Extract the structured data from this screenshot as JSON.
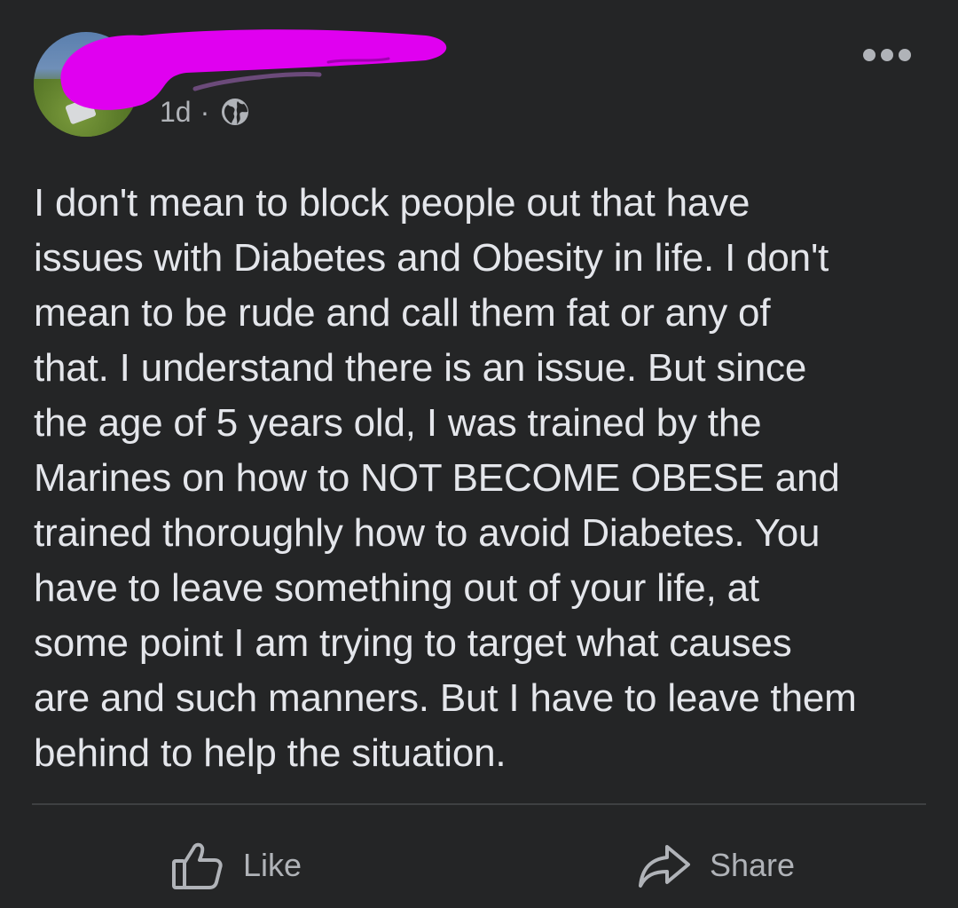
{
  "post": {
    "timestamp": "1d",
    "separator": "·",
    "audience_icon": "globe-icon",
    "menu_icon": "more-options-icon",
    "text": "I don't mean to block people out that have\nissues with Diabetes and Obesity in life. I don't\nmean to be rude and call them fat or any of\nthat. I understand there is an issue. But since\nthe age of 5 years old, I was trained by the\nMarines on how to NOT BECOME OBESE and\ntrained thoroughly how to avoid Diabetes. You\nhave to leave something out of your life, at\nsome point I am trying to target what causes\nare and such manners. But I have to leave them\nbehind to help the situation."
  },
  "actions": {
    "like_label": "Like",
    "share_label": "Share"
  },
  "colors": {
    "background": "#242526",
    "text": "#e4e6eb",
    "secondary_text": "#b0b3b8",
    "redaction": "#e000f0"
  }
}
